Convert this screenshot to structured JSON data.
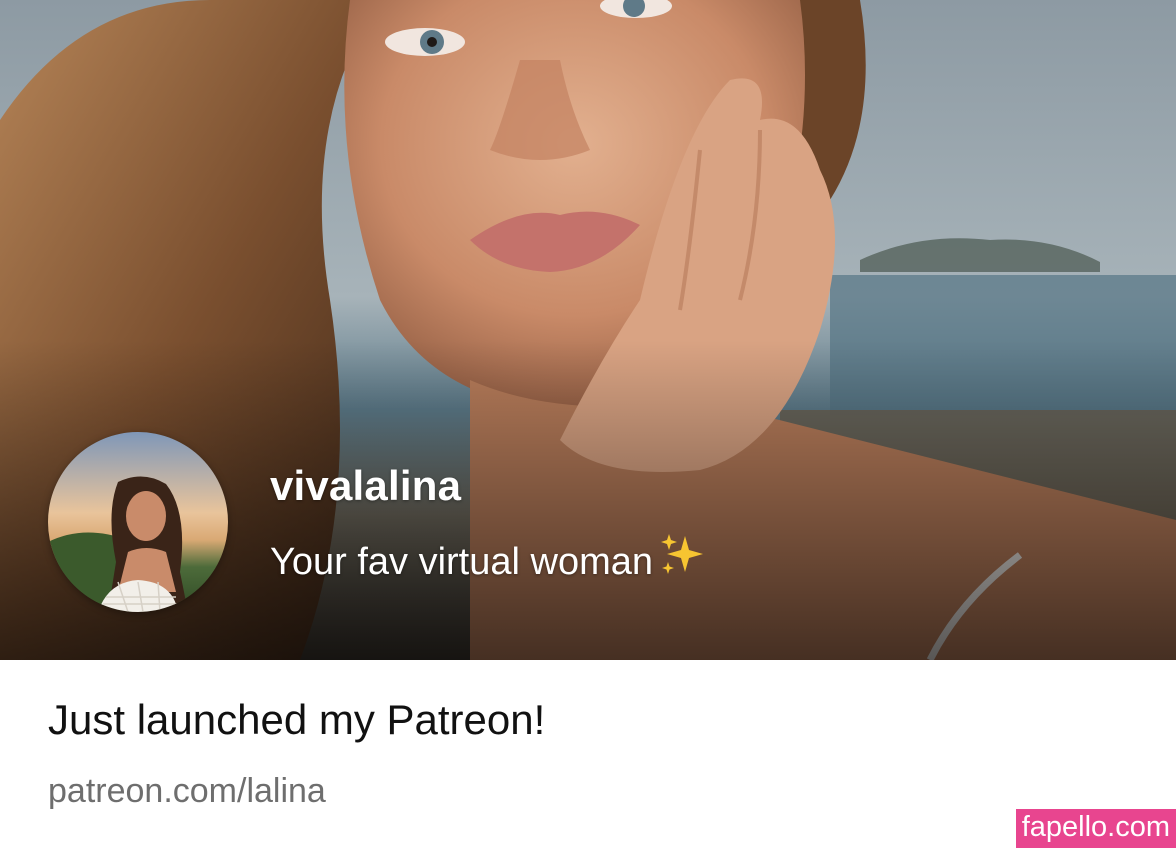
{
  "profile": {
    "name": "vivalalina",
    "tagline": "Your fav virtual woman",
    "tagline_icon": "sparkles-icon"
  },
  "post": {
    "headline": "Just launched my Patreon!",
    "link": "patreon.com/lalina"
  },
  "watermark": {
    "text": "fapello.com",
    "color": "#e8458f"
  },
  "colors": {
    "headline_text": "#111111",
    "link_text": "#6e6e6e",
    "banner_text": "#ffffff"
  }
}
